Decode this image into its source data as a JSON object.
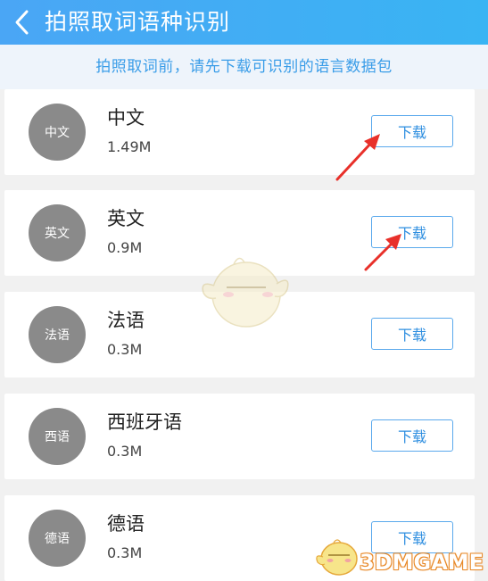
{
  "header": {
    "title": "拍照取词语种识别"
  },
  "notice": "拍照取词前，请先下载可识别的语言数据包",
  "languages": [
    {
      "avatar": "中文",
      "name": "中文",
      "size": "1.49M",
      "button": "下载"
    },
    {
      "avatar": "英文",
      "name": "英文",
      "size": "0.9M",
      "button": "下载"
    },
    {
      "avatar": "法语",
      "name": "法语",
      "size": "0.3M",
      "button": "下载"
    },
    {
      "avatar": "西语",
      "name": "西班牙语",
      "size": "0.3M",
      "button": "下载"
    },
    {
      "avatar": "德语",
      "name": "德语",
      "size": "0.3M",
      "button": "下载"
    }
  ],
  "watermark": {
    "text": "3DMGAME"
  },
  "colors": {
    "header_bg": "#4aa6f5",
    "notice_text": "#3a9de8",
    "button_border": "#5aa9ec",
    "avatar_bg": "#8a8a8a",
    "arrow": "#e8302a"
  },
  "icons": {
    "back": "back-arrow-icon",
    "annotation": "red-arrow-icon",
    "mascot": "mascot-icon"
  }
}
